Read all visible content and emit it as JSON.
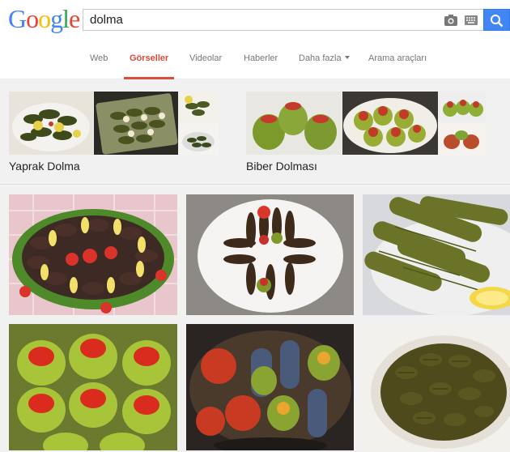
{
  "logo": {
    "letters": [
      "G",
      "o",
      "o",
      "g",
      "l",
      "e"
    ],
    "colors": [
      "#4285f4",
      "#ea4335",
      "#fbbc05",
      "#4285f4",
      "#34a853",
      "#ea4335"
    ]
  },
  "search": {
    "query": "dolma"
  },
  "tabs": [
    {
      "label": "Web"
    },
    {
      "label": "Görseller"
    },
    {
      "label": "Videolar"
    },
    {
      "label": "Haberler"
    },
    {
      "label": "Daha fazla"
    },
    {
      "label": "Arama araçları"
    }
  ],
  "related": [
    {
      "label": "Yaprak Dolma"
    },
    {
      "label": "Biber Dolması"
    }
  ],
  "colors": {
    "accent": "#dd4b39",
    "search_button": "#4285f4"
  }
}
